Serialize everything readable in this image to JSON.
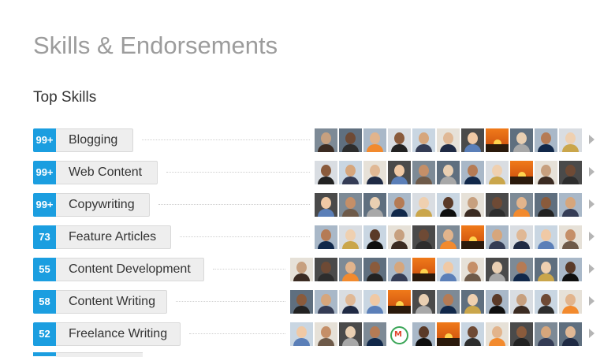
{
  "header": {
    "title": "Skills & Endorsements",
    "subtitle": "Top Skills"
  },
  "colors": {
    "count_badge": "#1b9ee0",
    "pill_bg": "#eeeeee",
    "title_gray": "#9c9c9c"
  },
  "skills": [
    {
      "count": "99+",
      "label": "Blogging"
    },
    {
      "count": "99+",
      "label": "Web Content"
    },
    {
      "count": "99+",
      "label": "Copywriting"
    },
    {
      "count": "73",
      "label": "Feature Articles"
    },
    {
      "count": "55",
      "label": "Content Development"
    },
    {
      "count": "58",
      "label": "Content Writing"
    },
    {
      "count": "52",
      "label": "Freelance Writing"
    }
  ],
  "icons": {
    "row_expand": "chevron-right-icon",
    "endorser": "avatar"
  }
}
